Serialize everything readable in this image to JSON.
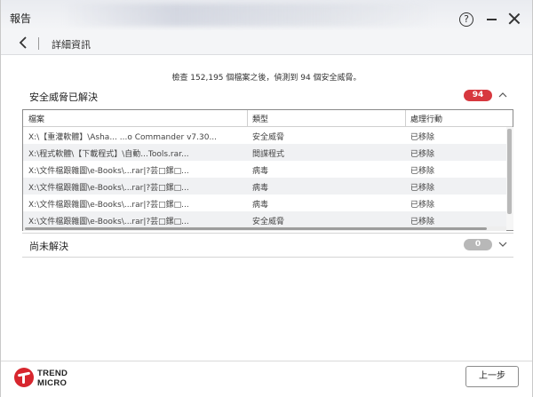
{
  "window": {
    "title": "報告",
    "help_glyph": "?",
    "nav_title": "詳細資訊"
  },
  "summary": "檢查 152,195 個檔案之後，偵測到 94 個安全威脅。",
  "resolved": {
    "title": "安全威脅已解決",
    "count": "94",
    "badge_color": "#d7383f"
  },
  "table": {
    "headers": [
      "檔案",
      "類型",
      "處理行動"
    ],
    "rows": [
      {
        "file": "X:\\【重灌軟體】\\Asha... ...o Commander v7.30...",
        "type": "安全威脅",
        "action": "已移除"
      },
      {
        "file": "X:\\程式軟體\\【下載程式】\\自動...Tools.rar...",
        "type": "間諜程式",
        "action": "已移除"
      },
      {
        "file": "X:\\文件檔跟雜圖\\e-Books\\...rar|?芸□鏍□...",
        "type": "病毒",
        "action": "已移除"
      },
      {
        "file": "X:\\文件檔跟雜圖\\e-Books\\...rar|?芸□鏍□...",
        "type": "病毒",
        "action": "已移除"
      },
      {
        "file": "X:\\文件檔跟雜圖\\e-Books\\...rar|?芸□鏍□...",
        "type": "病毒",
        "action": "已移除"
      },
      {
        "file": "X:\\文件檔跟雜圖\\e-Books\\...rar|?芸□鏍□...",
        "type": "安全威脅",
        "action": "已移除"
      }
    ]
  },
  "unresolved": {
    "title": "尚未解決",
    "count": "0",
    "badge_color": "#b8b8b8"
  },
  "footer": {
    "logo_line1": "TREND",
    "logo_line2": "MICRO",
    "back_button": "上一步"
  },
  "icons": {
    "help": "help-icon",
    "minimize": "minimize-icon",
    "close": "close-icon",
    "back": "back-arrow-icon",
    "collapse": "chevron-up-icon",
    "expand": "chevron-down-icon"
  }
}
